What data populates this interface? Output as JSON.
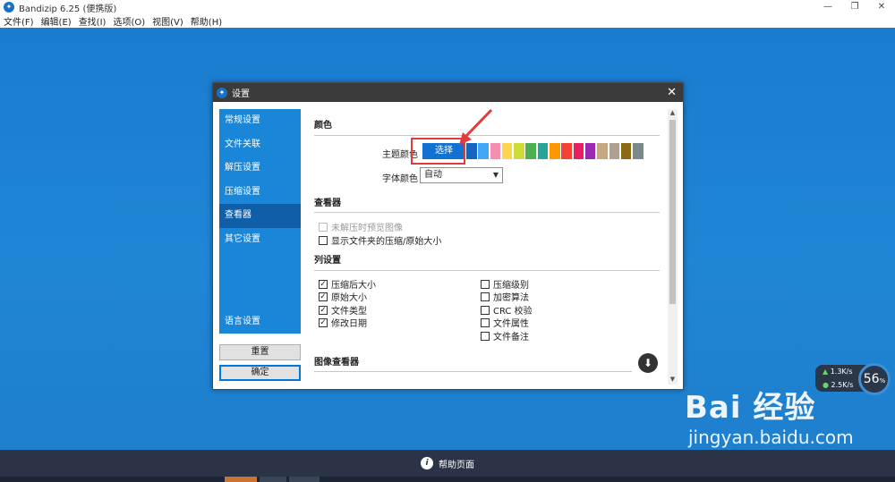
{
  "window": {
    "title": "Bandizip 6.25 (便携版)",
    "controls": [
      "—",
      "❐",
      "✕"
    ]
  },
  "menu": [
    "文件(F)",
    "编辑(E)",
    "查找(I)",
    "选项(O)",
    "视图(V)",
    "帮助(H)"
  ],
  "dialog": {
    "title": "设置",
    "sidebar": [
      "常规设置",
      "文件关联",
      "解压设置",
      "压缩设置",
      "查看器",
      "其它设置"
    ],
    "sidebar_lang": "语言设置",
    "reset_button": "重置",
    "ok_button": "确定",
    "sections": {
      "color": "颜色",
      "viewer": "查看器",
      "columns": "列设置",
      "image_viewer": "图像查看器"
    },
    "theme_color_label": "主题颜色",
    "choose_button": "选择",
    "font_color_label": "字体颜色",
    "font_color_value": "自动",
    "swatch_colors": [
      "#1565c0",
      "#42a5f5",
      "#f48fb1",
      "#ffd54f",
      "#cddc39",
      "#4caf50",
      "#26a69a",
      "#ff9800",
      "#f44336",
      "#e91e63",
      "#9c27b0",
      "#c5a880",
      "#b0a090",
      "#8b6914",
      "#7a8a8a"
    ],
    "viewer_options": [
      {
        "label": "未解压时预览图像",
        "checked": false,
        "disabled": true
      },
      {
        "label": "显示文件夹的压缩/原始大小",
        "checked": false,
        "disabled": false
      }
    ],
    "columns_left": [
      {
        "label": "压缩后大小",
        "checked": true
      },
      {
        "label": "原始大小",
        "checked": true
      },
      {
        "label": "文件类型",
        "checked": true
      },
      {
        "label": "修改日期",
        "checked": true
      }
    ],
    "columns_right": [
      {
        "label": "压缩级别",
        "checked": false
      },
      {
        "label": "加密算法",
        "checked": false
      },
      {
        "label": "CRC 校验",
        "checked": false
      },
      {
        "label": "文件属性",
        "checked": false
      },
      {
        "label": "文件备注",
        "checked": false
      }
    ]
  },
  "speed": {
    "up": "1.3K/s",
    "down": "2.5K/s",
    "percent": "56",
    "unit": "%"
  },
  "watermark": {
    "brand": "Bai 经验",
    "url": "jingyan.baidu.com"
  },
  "help": {
    "label": "帮助页面"
  },
  "colors": {
    "accent": "#1272d4",
    "sidebar": "#1a86d8",
    "highlight": "#e23b3b"
  }
}
